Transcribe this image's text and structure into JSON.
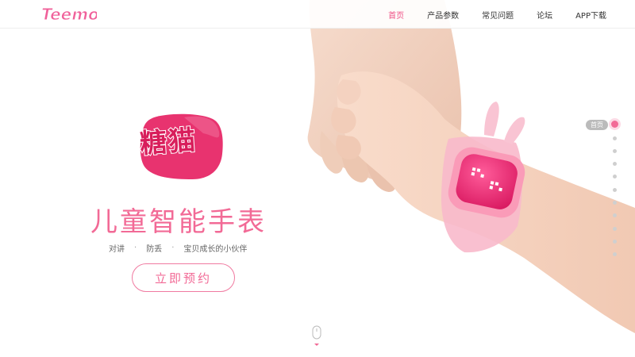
{
  "header": {
    "logo_text": "Teemo",
    "nav": [
      {
        "label": "首页",
        "active": true
      },
      {
        "label": "产品参数",
        "active": false
      },
      {
        "label": "常见问题",
        "active": false
      },
      {
        "label": "论坛",
        "active": false
      },
      {
        "label": "APP下载",
        "active": false
      }
    ]
  },
  "hero": {
    "brand": "糖猫",
    "headline": "儿童智能手表",
    "tagline": [
      "对讲",
      "防丢",
      "宝贝成长的小伙伴"
    ],
    "tagline_separator": "·",
    "cta_label": "立即预约"
  },
  "pager": {
    "current_label": "首页",
    "dot_count": 11,
    "active_index": 0
  },
  "colors": {
    "accent": "#f26a96",
    "brand_red": "#d81e5b",
    "logo_pink": "#f0609a"
  },
  "icons": {
    "scroll": "mouse-scroll-icon"
  }
}
